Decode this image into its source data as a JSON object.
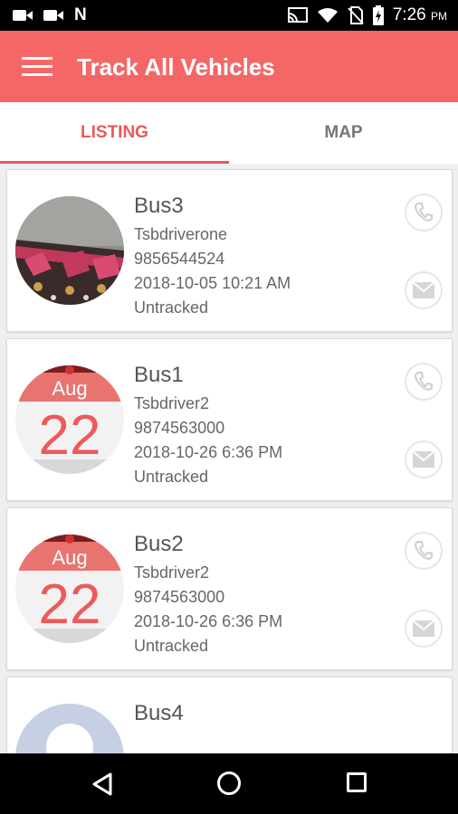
{
  "status_bar": {
    "time": "7:26",
    "time_suffix": "PM",
    "icons": [
      "video-camera-icon",
      "video-camera-icon",
      "n-notification-icon",
      "cast-icon",
      "wifi-icon",
      "no-sim-icon",
      "battery-charging-icon"
    ]
  },
  "app_bar": {
    "title": "Track All Vehicles",
    "menu_icon": "hamburger-menu-icon"
  },
  "tabs": [
    {
      "label": "LISTING",
      "selected": true
    },
    {
      "label": "MAP",
      "selected": false
    }
  ],
  "vehicles": [
    {
      "name": "Bus3",
      "driver": "Tsbdriverone",
      "phone": "9856544524",
      "datetime": "2018-10-05 10:21 AM",
      "status": "Untracked",
      "avatar": "photo"
    },
    {
      "name": "Bus1",
      "driver": "Tsbdriver2",
      "phone": "9874563000",
      "datetime": "2018-10-26 6:36 PM",
      "status": "Untracked",
      "avatar": "calendar",
      "avatar_month": "Aug",
      "avatar_day": "22"
    },
    {
      "name": "Bus2",
      "driver": "Tsbdriver2",
      "phone": "9874563000",
      "datetime": "2018-10-26 6:36 PM",
      "status": "Untracked",
      "avatar": "calendar",
      "avatar_month": "Aug",
      "avatar_day": "22"
    },
    {
      "name": "Bus4",
      "avatar": "default-person"
    }
  ],
  "colors": {
    "accent": "#f56767",
    "tab_selected": "#e85a5a",
    "tab_unselected": "#777777"
  },
  "nav_bar": {
    "icons": [
      "back-icon",
      "home-icon",
      "recent-apps-icon"
    ]
  }
}
